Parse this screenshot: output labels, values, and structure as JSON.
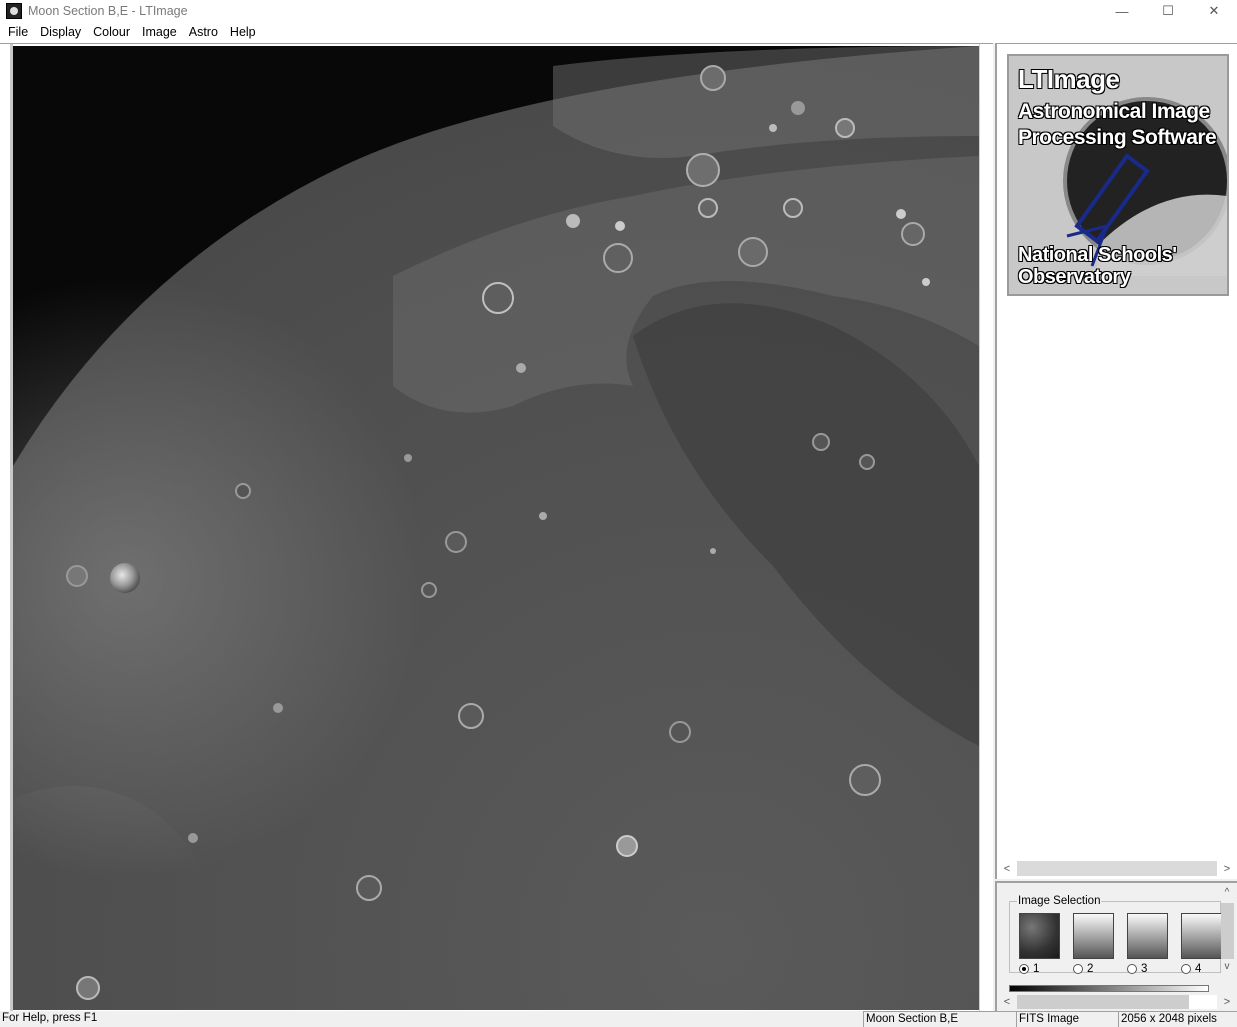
{
  "window": {
    "title": "Moon Section B,E - LTImage",
    "minimize": "—",
    "maximize": "☐",
    "close": "✕"
  },
  "menu": [
    "File",
    "Display",
    "Colour",
    "Image",
    "Astro",
    "Help"
  ],
  "logo": {
    "title": "LTImage",
    "subtitle_line1": "Astronomical Image",
    "subtitle_line2": "Processing Software",
    "org_line1": "National Schools'",
    "org_line2": "Observatory"
  },
  "image_selection": {
    "label": "Image Selection",
    "options": [
      {
        "label": "1",
        "selected": true
      },
      {
        "label": "2",
        "selected": false
      },
      {
        "label": "3",
        "selected": false
      },
      {
        "label": "4",
        "selected": false
      }
    ]
  },
  "scroll": {
    "left": "<",
    "right": ">",
    "up": "^",
    "down": "v"
  },
  "status": {
    "help": "For Help, press F1",
    "image_name": "Moon Section B,E",
    "image_type": "FITS Image",
    "dimensions": "2056 x 2048 pixels"
  }
}
